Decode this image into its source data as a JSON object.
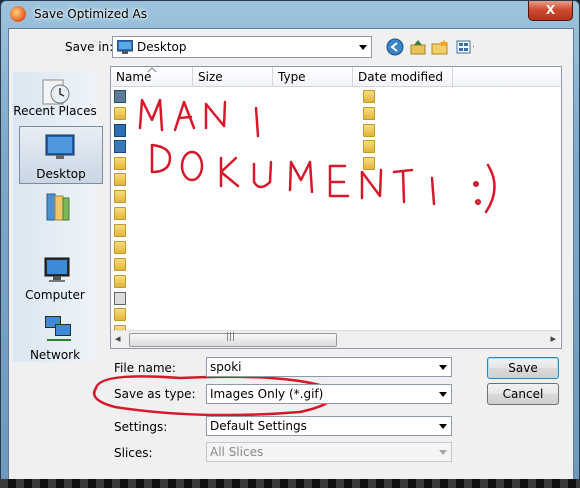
{
  "window": {
    "title": "Save Optimized As",
    "close_label": "X"
  },
  "toolbar": {
    "save_in_label": "Save in:",
    "save_in_value": "Desktop"
  },
  "places": [
    {
      "label": "Recent Places",
      "icon": "recent-places-icon"
    },
    {
      "label": "Desktop",
      "icon": "desktop-icon",
      "selected": true
    },
    {
      "label": "",
      "icon": "libraries-icon"
    },
    {
      "label": "Computer",
      "icon": "computer-icon"
    },
    {
      "label": "Network",
      "icon": "network-icon"
    }
  ],
  "file_list": {
    "columns": [
      "Name",
      "Size",
      "Type",
      "Date modified"
    ],
    "scroll_left": "◂",
    "scroll_right": "▸",
    "scroll_grip": "|||"
  },
  "form": {
    "file_name_label": "File name:",
    "file_name_value": "spoki",
    "save_as_type_label": "Save as type:",
    "save_as_type_value": "Images Only (*.gif)",
    "settings_label": "Settings:",
    "settings_value": "Default Settings",
    "slices_label": "Slices:",
    "slices_value": "All Slices"
  },
  "buttons": {
    "save": "Save",
    "cancel": "Cancel"
  },
  "annotation": {
    "line1": "MANI",
    "line2": "DOKUMENTI :)",
    "color": "#d8182a"
  },
  "colors": {
    "accent": "#3c7fb1",
    "title_bar": "#7fa9c9"
  }
}
